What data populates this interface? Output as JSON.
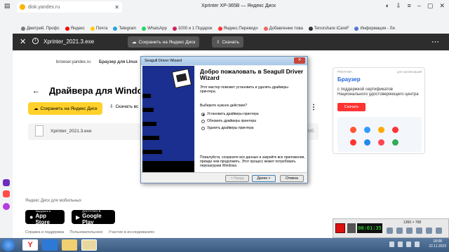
{
  "browser": {
    "tab_title": "Xprinter XP-365B",
    "window_title": "Xprinter XP-365B — Яндекс Диск",
    "address": "disk.yandex.ru",
    "bookmarks": [
      "Дмитрий. Профс",
      "Яндекс",
      "Почта",
      "Telegram",
      "WhatsApp",
      "1000 и 1 Подарок",
      "Яндекс.Переводч",
      "Добавление това",
      "Tenorshare iCareF",
      "Информация - Ли"
    ]
  },
  "disk_toolbar": {
    "file_name": "Xprinter_2021.3.exe",
    "save_label": "Сохранить на Яндекс Диск",
    "download_label": "Скачать"
  },
  "page": {
    "crumbs": [
      "browser.yandex.ru",
      "Браузер для Linux"
    ],
    "title": "Драйвера для Windo",
    "save_label": "Сохранить на Яндекс Диск",
    "download_label": "Скачать вс",
    "file_name": "Xprinter_2021.3.exe",
    "file_size": "МБ"
  },
  "ad": {
    "tag": "РЕКЛАМА",
    "tag2": "для организаций",
    "brand": "Браузер",
    "text": "с поддержкой сертификатов Национального удостоверяющего центра",
    "button": "Скачать"
  },
  "footer": {
    "mobile_text": "Яндекс Диск для мобильных",
    "appstore_small": "Загрузите в",
    "appstore_big": "App Store",
    "gplay_small": "ДОСТУПНО В",
    "gplay_big": "Google Play",
    "links": [
      "Справка и поддержка",
      "Пользовательское",
      "Участие в исследованиях"
    ]
  },
  "wizard": {
    "title": "Seagull Driver Wizard",
    "heading": "Добро пожаловать в Seagull Driver Wizard",
    "intro": "Этот мастер поможет установить и удалить драйверы принтера.",
    "question": "Выберите нужное действие?",
    "options": [
      "Установить драйверы принтера",
      "Обновить драйверы принтера",
      "Удалить драйверы принтера"
    ],
    "footer": "Пожалуйста, сохраните все данные и закройте все приложения, прежде чем продолжить. Этот процесс может потребовать перезагрузки Windows.",
    "back_label": "< Назад",
    "next_label": "Далее >",
    "cancel_label": "Отмена"
  },
  "recorder": {
    "time": "00:01:35",
    "resolution": "1366 × 768"
  },
  "taskbar": {
    "time": "18:08",
    "date": "22.11.2023"
  }
}
